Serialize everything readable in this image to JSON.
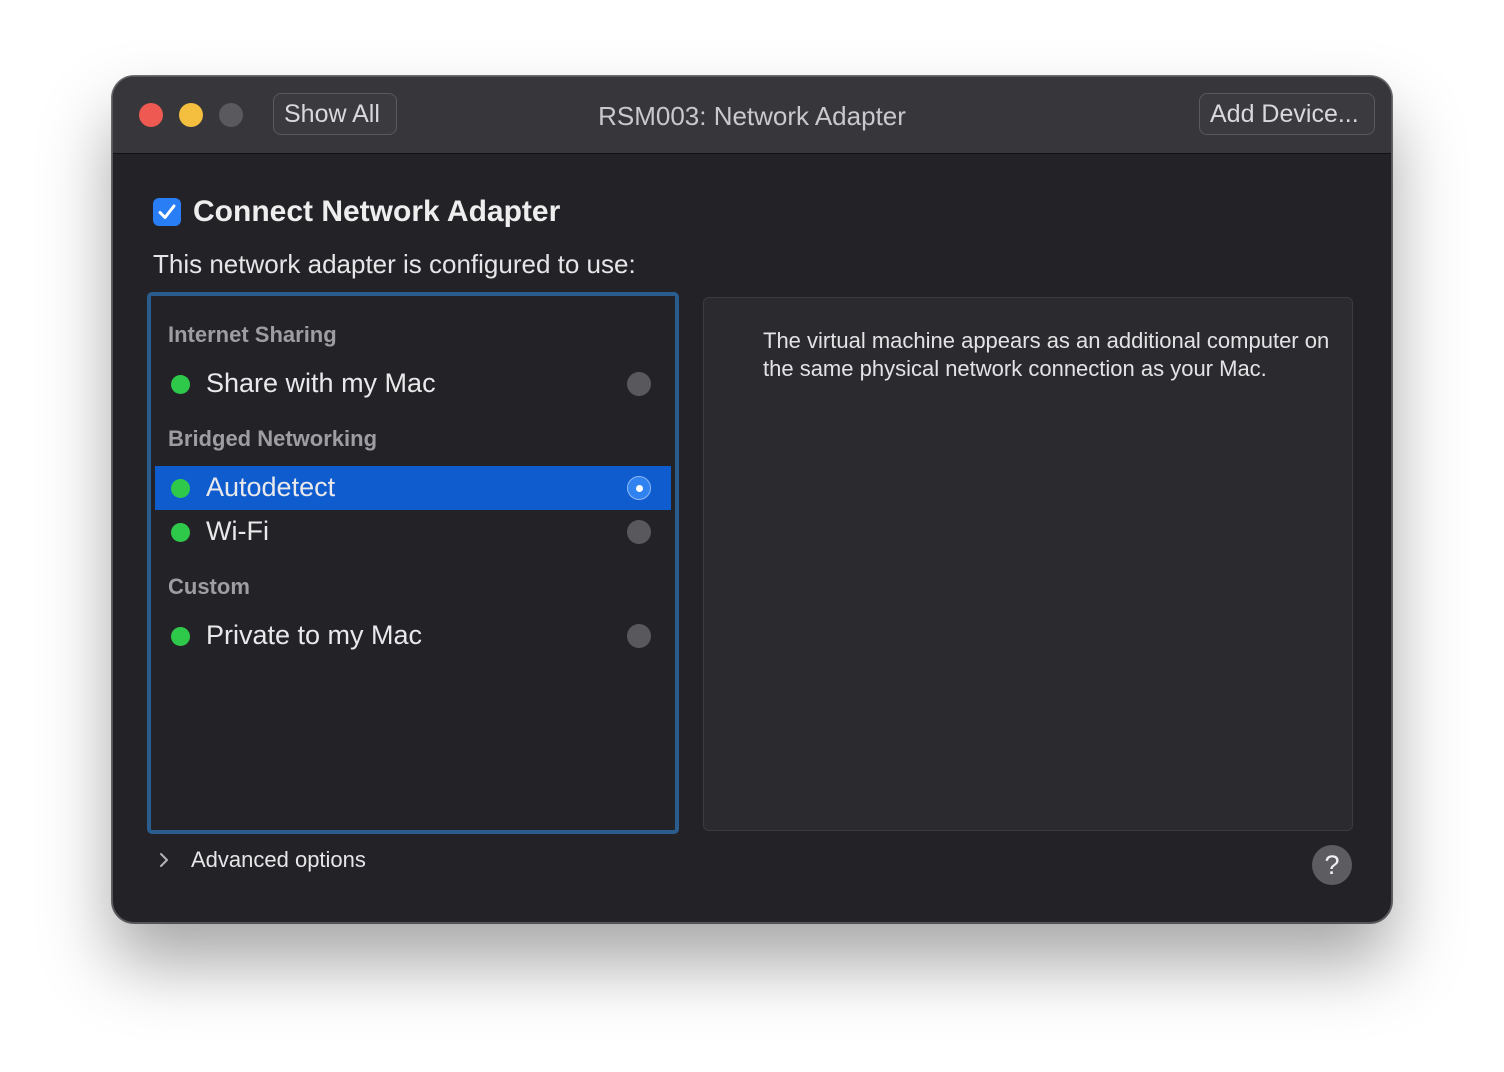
{
  "window": {
    "title": "RSM003: Network Adapter"
  },
  "toolbar": {
    "show_all_label": "Show All",
    "add_device_label": "Add Device..."
  },
  "connect": {
    "label": "Connect Network Adapter",
    "checked": true
  },
  "config_label": "This network adapter is configured to use:",
  "sections": {
    "internet_sharing": {
      "header": "Internet Sharing",
      "options": [
        {
          "label": "Share with my Mac",
          "status": "green",
          "selected": false
        }
      ]
    },
    "bridged": {
      "header": "Bridged Networking",
      "options": [
        {
          "label": "Autodetect",
          "status": "green",
          "selected": true
        },
        {
          "label": "Wi-Fi",
          "status": "green",
          "selected": false
        }
      ]
    },
    "custom": {
      "header": "Custom",
      "options": [
        {
          "label": "Private to my Mac",
          "status": "green",
          "selected": false
        }
      ]
    }
  },
  "description": "The virtual machine appears as an additional computer on the same physical network connection as your Mac.",
  "advanced_options_label": "Advanced options",
  "help_label": "?",
  "colors": {
    "accent": "#0f5ccf",
    "status_green": "#2ec94b",
    "checkbox": "#2a7ef5"
  }
}
